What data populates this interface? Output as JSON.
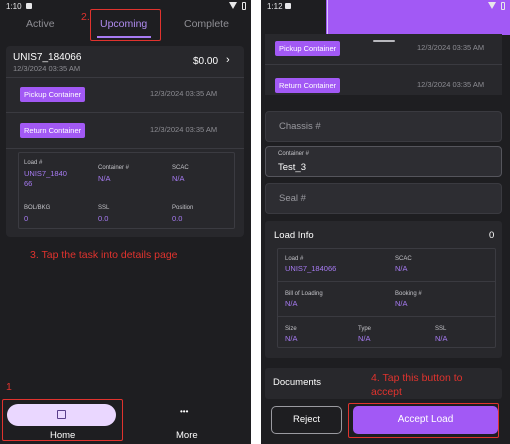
{
  "left": {
    "status": {
      "time": "1:10"
    },
    "tabs": [
      {
        "label": "Active"
      },
      {
        "label": "Upcoming"
      },
      {
        "label": "Complete"
      }
    ],
    "card": {
      "title": "UNIS7_184066",
      "date": "12/3/2024 03:35 AM",
      "amount": "$0.00",
      "steps": [
        {
          "button": "Pickup Container",
          "time": "12/3/2024 03:35 AM"
        },
        {
          "button": "Return Container",
          "time": "12/3/2024 03:35 AM"
        }
      ],
      "grid": {
        "load_label": "Load #",
        "load_value_l1": "UNIS7_1840",
        "load_value_l2": "66",
        "container_label": "Container #",
        "container_value": "N/A",
        "scac_label": "SCAC",
        "scac_value": "N/A",
        "bol_label": "BOL/BKG",
        "bol_value": "0",
        "ssl_label": "SSL",
        "ssl_value": "0.0",
        "position_label": "Position",
        "position_value": "0.0"
      }
    },
    "annotations": {
      "num1": "1",
      "num2": "2.",
      "step3": "3. Tap the task into details page"
    },
    "nav": {
      "home": "Home",
      "more": "More",
      "more_icon": "•••"
    }
  },
  "right": {
    "status": {
      "time": "1:12"
    },
    "steps": [
      {
        "button": "Pickup Container",
        "time": "12/3/2024 03:35 AM"
      },
      {
        "button": "Return Container",
        "time": "12/3/2024 03:35 AM"
      }
    ],
    "fields": {
      "chassis_placeholder": "Chassis #",
      "container_label": "Container #",
      "container_value": "Test_3",
      "seal_placeholder": "Seal #"
    },
    "load_info": {
      "title": "Load Info",
      "count": "0",
      "load_label": "Load #",
      "load_value": "UNIS7_184066",
      "scac_label": "SCAC",
      "scac_value": "N/A",
      "bol_label": "Bill of Loading",
      "bol_value": "N/A",
      "booking_label": "Booking #",
      "booking_value": "N/A",
      "size_label": "Size",
      "size_value": "N/A",
      "type_label": "Type",
      "type_value": "N/A",
      "ssl_label": "SSL",
      "ssl_value": "N/A"
    },
    "documents_title": "Documents",
    "annotation_step4_l1": "4. Tap this button to",
    "annotation_step4_l2": "accept",
    "reject_label": "Reject",
    "accept_label": "Accept Load"
  },
  "colors": {
    "accent": "#a259f5",
    "accent_text": "#a77bf3",
    "background": "#1e1e21",
    "card": "#28282c",
    "annotation": "#e0332e",
    "home_pill": "#ead7ff"
  }
}
